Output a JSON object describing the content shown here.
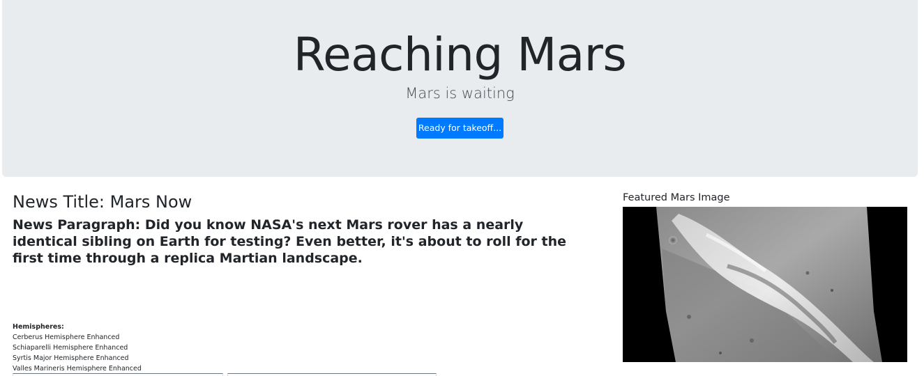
{
  "jumbotron": {
    "title": "Reaching Mars",
    "lead": "Mars is waiting",
    "button_label": "Ready for takeoff..."
  },
  "news": {
    "title": "News Title: Mars Now",
    "paragraph": "News Paragraph: Did you know NASA's next Mars rover has a nearly identical sibling on Earth for testing? Even better, it's about to roll for the first time through a replica Martian landscape."
  },
  "hemispheres": {
    "label": "Hemispheres:",
    "items": [
      "Cerberus Hemisphere Enhanced",
      "Schiaparelli Hemisphere Enhanced",
      "Syrtis Major Hemisphere Enhanced",
      "Valles Marineris Hemisphere Enhanced"
    ]
  },
  "featured": {
    "label": "Featured Mars Image"
  },
  "colors": {
    "jumbotron_bg": "#e9ecef",
    "button_primary": "#007bff",
    "text": "#212529"
  }
}
